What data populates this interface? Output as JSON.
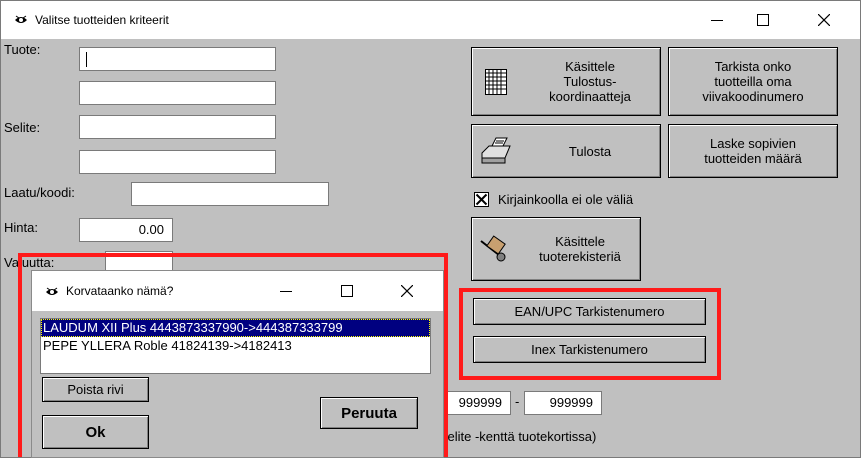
{
  "main_window": {
    "title": "Valitse tuotteiden kriteerit",
    "labels": {
      "tuote": "Tuote:",
      "selite": "Selite:",
      "laatu": "Laatu/koodi:",
      "hinta": "Hinta:",
      "valuutta": "Valuutta:"
    },
    "fields": {
      "hinta_value": "0.00",
      "range_from": "999999",
      "range_dash": "-",
      "range_to": "999999"
    },
    "buttons": {
      "kasittele_tulostus": [
        "Käsittele",
        "Tulostus-",
        "koordinaatteja"
      ],
      "tarkista_viivakoodi": [
        "Tarkista onko",
        "tuotteilla oma",
        "viivakoodinumero"
      ],
      "tulosta": "Tulosta",
      "laske_maara": [
        "Laske sopivien",
        "tuotteiden määrä"
      ],
      "kasittele_tuoterekisteria": [
        "Käsittele",
        "tuoterekisteriä"
      ],
      "ean_upc": "EAN/UPC Tarkistenumero",
      "inex": "Inex Tarkistenumero"
    },
    "checkbox_case_insensitive": {
      "label": "Kirjainkoolla ei ole väliä",
      "checked": true
    },
    "note_text": "selite -kenttä tuotekortissa)"
  },
  "dialog": {
    "title": "Korvataanko nämä?",
    "list_items": [
      "LAUDUM XII Plus 4443873337990->444387333799",
      "PEPE YLLERA Roble 41824139->4182413"
    ],
    "selected_index": 0,
    "buttons": {
      "poista_rivi": "Poista rivi",
      "ok": "Ok",
      "peruuta": "Peruuta"
    }
  },
  "highlight_color": "#ff1a1a",
  "selection_color": "#000080"
}
